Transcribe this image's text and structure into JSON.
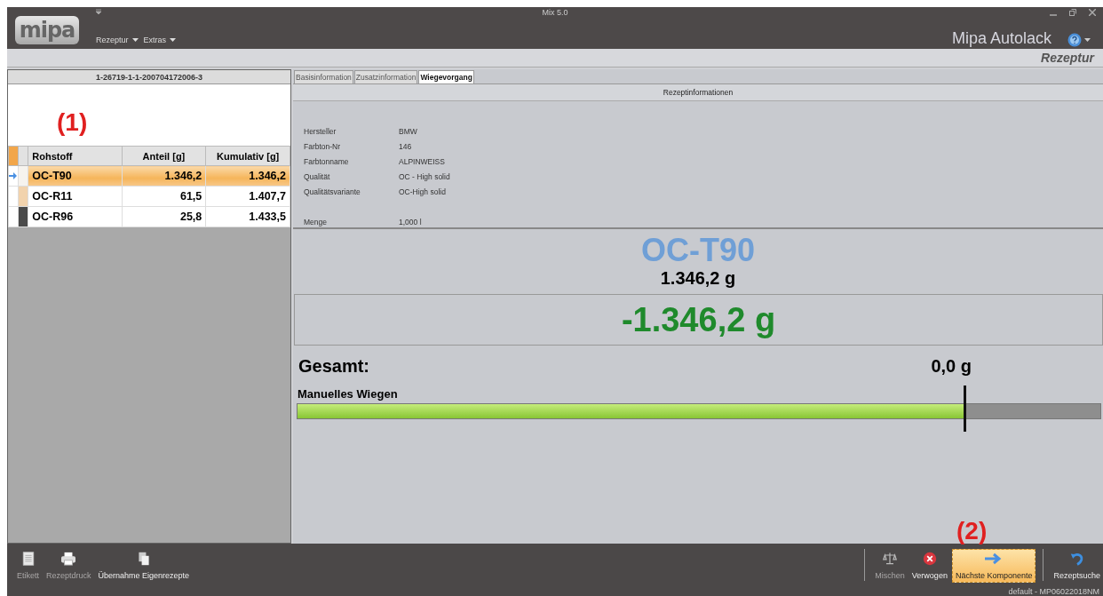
{
  "window": {
    "title": "Mix 5.0",
    "brand": "Mipa Autolack"
  },
  "logo": "mipa",
  "menu": [
    {
      "label": "Rezeptur"
    },
    {
      "label": "Extras"
    }
  ],
  "toolbar": {
    "section": "Rezeptur"
  },
  "recipe": {
    "id": "1-26719-1-1-200704172006-3",
    "columns": [
      "Rohstoff",
      "Anteil [g]",
      "Kumulativ [g]"
    ],
    "rows": [
      {
        "rohstoff": "OC-T90",
        "anteil": "1.346,2",
        "kumulativ": "1.346,2",
        "color": "#f6f3ee",
        "selected": true
      },
      {
        "rohstoff": "OC-R11",
        "anteil": "61,5",
        "kumulativ": "1.407,7",
        "color": "#f2d3ad",
        "selected": false
      },
      {
        "rohstoff": "OC-R96",
        "anteil": "25,8",
        "kumulativ": "1.433,5",
        "color": "#4a4a4a",
        "selected": false
      }
    ]
  },
  "tabs": [
    {
      "label": "Basisinformation",
      "selected": false
    },
    {
      "label": "Zusatzinformation",
      "selected": false
    },
    {
      "label": "Wiegevorgang",
      "selected": true
    }
  ],
  "info": {
    "title": "Rezeptinformationen",
    "fields": [
      {
        "label": "Hersteller",
        "value": "BMW"
      },
      {
        "label": "Farbton-Nr",
        "value": "146"
      },
      {
        "label": "Farbtonname",
        "value": "ALPINWEISS"
      },
      {
        "label": "Qualität",
        "value": "OC - High solid"
      },
      {
        "label": "Qualitätsvariante",
        "value": "OC-High solid"
      },
      {
        "label": "Menge",
        "value": "1,000 l"
      }
    ]
  },
  "weighing": {
    "component": "OC-T90",
    "target": "1.346,2 g",
    "remaining": "-1.346,2 g",
    "total_label": "Gesamt:",
    "total": "0,0 g",
    "mode": "Manuelles Wiegen",
    "level": 0.83
  },
  "actions_left": [
    {
      "label": "Etikett",
      "disabled": true
    },
    {
      "label": "Rezeptdruck",
      "disabled": true
    },
    {
      "label": "Übernahme Eigenrezepte",
      "disabled": false
    }
  ],
  "actions_right": [
    {
      "label": "Mischen",
      "disabled": true,
      "selected": false
    },
    {
      "label": "Verwogen",
      "disabled": false,
      "selected": false
    },
    {
      "label": "Nächste Komponente",
      "disabled": false,
      "selected": true
    },
    {
      "label": "Rezeptsuche",
      "disabled": false,
      "selected": false
    }
  ],
  "status": "default - MP06022018NM",
  "annotations": [
    "(1)",
    "(2)"
  ]
}
